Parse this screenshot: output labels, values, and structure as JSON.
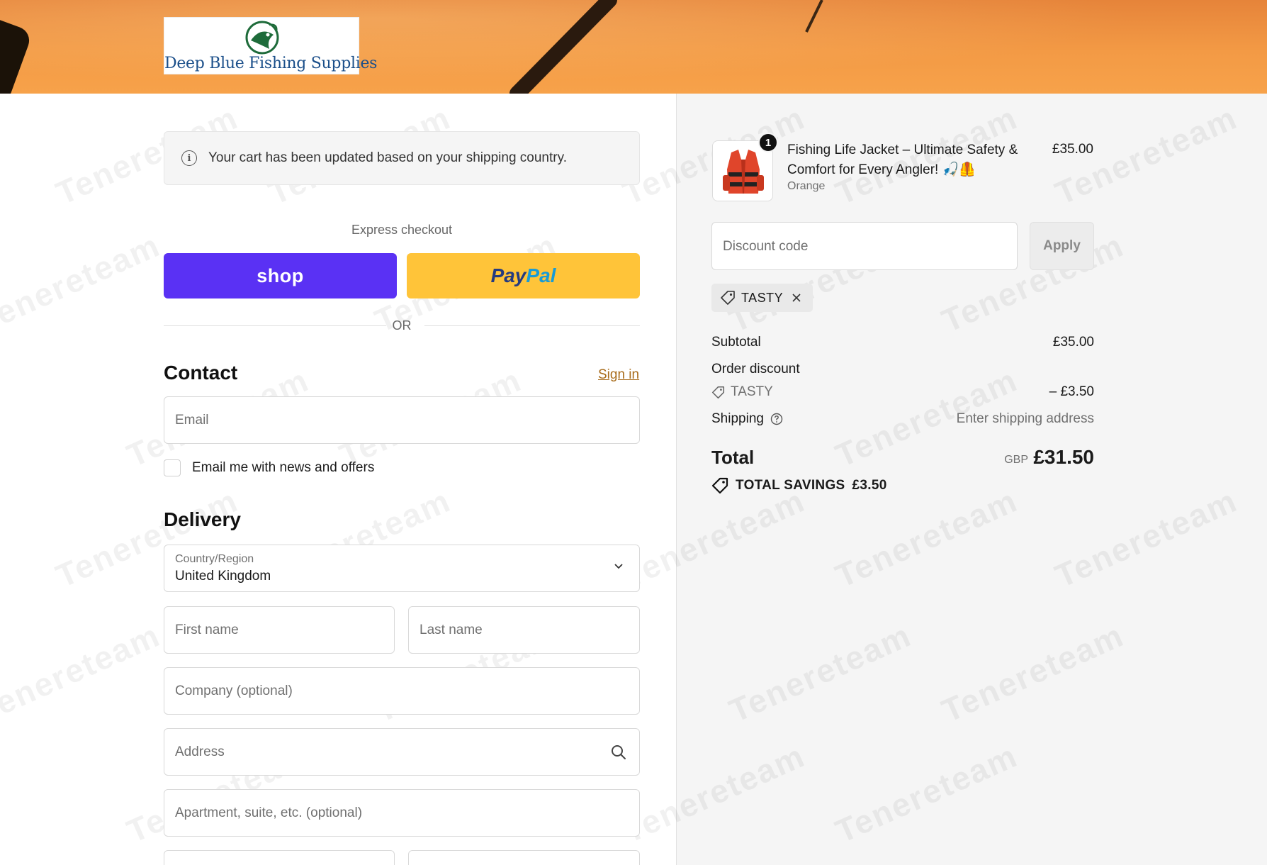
{
  "brand": {
    "name": "Deep Blue Fishing Supplies",
    "logo_icon": "fish-logo-icon"
  },
  "notice": {
    "text": "Your cart has been updated based on your shipping country.",
    "icon": "info-icon"
  },
  "express": {
    "label": "Express checkout",
    "shop_label": "shop",
    "paypal_part1": "Pay",
    "paypal_part2": "Pal",
    "or_label": "OR"
  },
  "contact": {
    "title": "Contact",
    "sign_in": "Sign in",
    "email_placeholder": "Email",
    "newsletter_label": "Email me with news and offers",
    "newsletter_checked": false
  },
  "delivery": {
    "title": "Delivery",
    "country_label": "Country/Region",
    "country_value": "United Kingdom",
    "first_name_placeholder": "First name",
    "last_name_placeholder": "Last name",
    "company_placeholder": "Company (optional)",
    "address_placeholder": "Address",
    "apartment_placeholder": "Apartment, suite, etc. (optional)"
  },
  "order": {
    "item": {
      "quantity": "1",
      "name": "Fishing Life Jacket – Ultimate Safety & Comfort for Every Angler! 🎣🦺",
      "variant": "Orange",
      "price": "£35.00"
    },
    "discount_placeholder": "Discount code",
    "apply_label": "Apply",
    "applied_code": "TASTY",
    "subtotal_label": "Subtotal",
    "subtotal_value": "£35.00",
    "order_discount_label": "Order discount",
    "discount_code": "TASTY",
    "discount_value": "– £3.50",
    "shipping_label": "Shipping",
    "shipping_value": "Enter shipping address",
    "total_label": "Total",
    "currency": "GBP",
    "total_value": "£31.50",
    "savings_label": "TOTAL SAVINGS",
    "savings_value": "£3.50"
  },
  "colors": {
    "shop_purple": "#5a31f4",
    "paypal_yellow": "#ffc439",
    "link_brown": "#a86b1a",
    "banner_orange": "#f39a45"
  }
}
